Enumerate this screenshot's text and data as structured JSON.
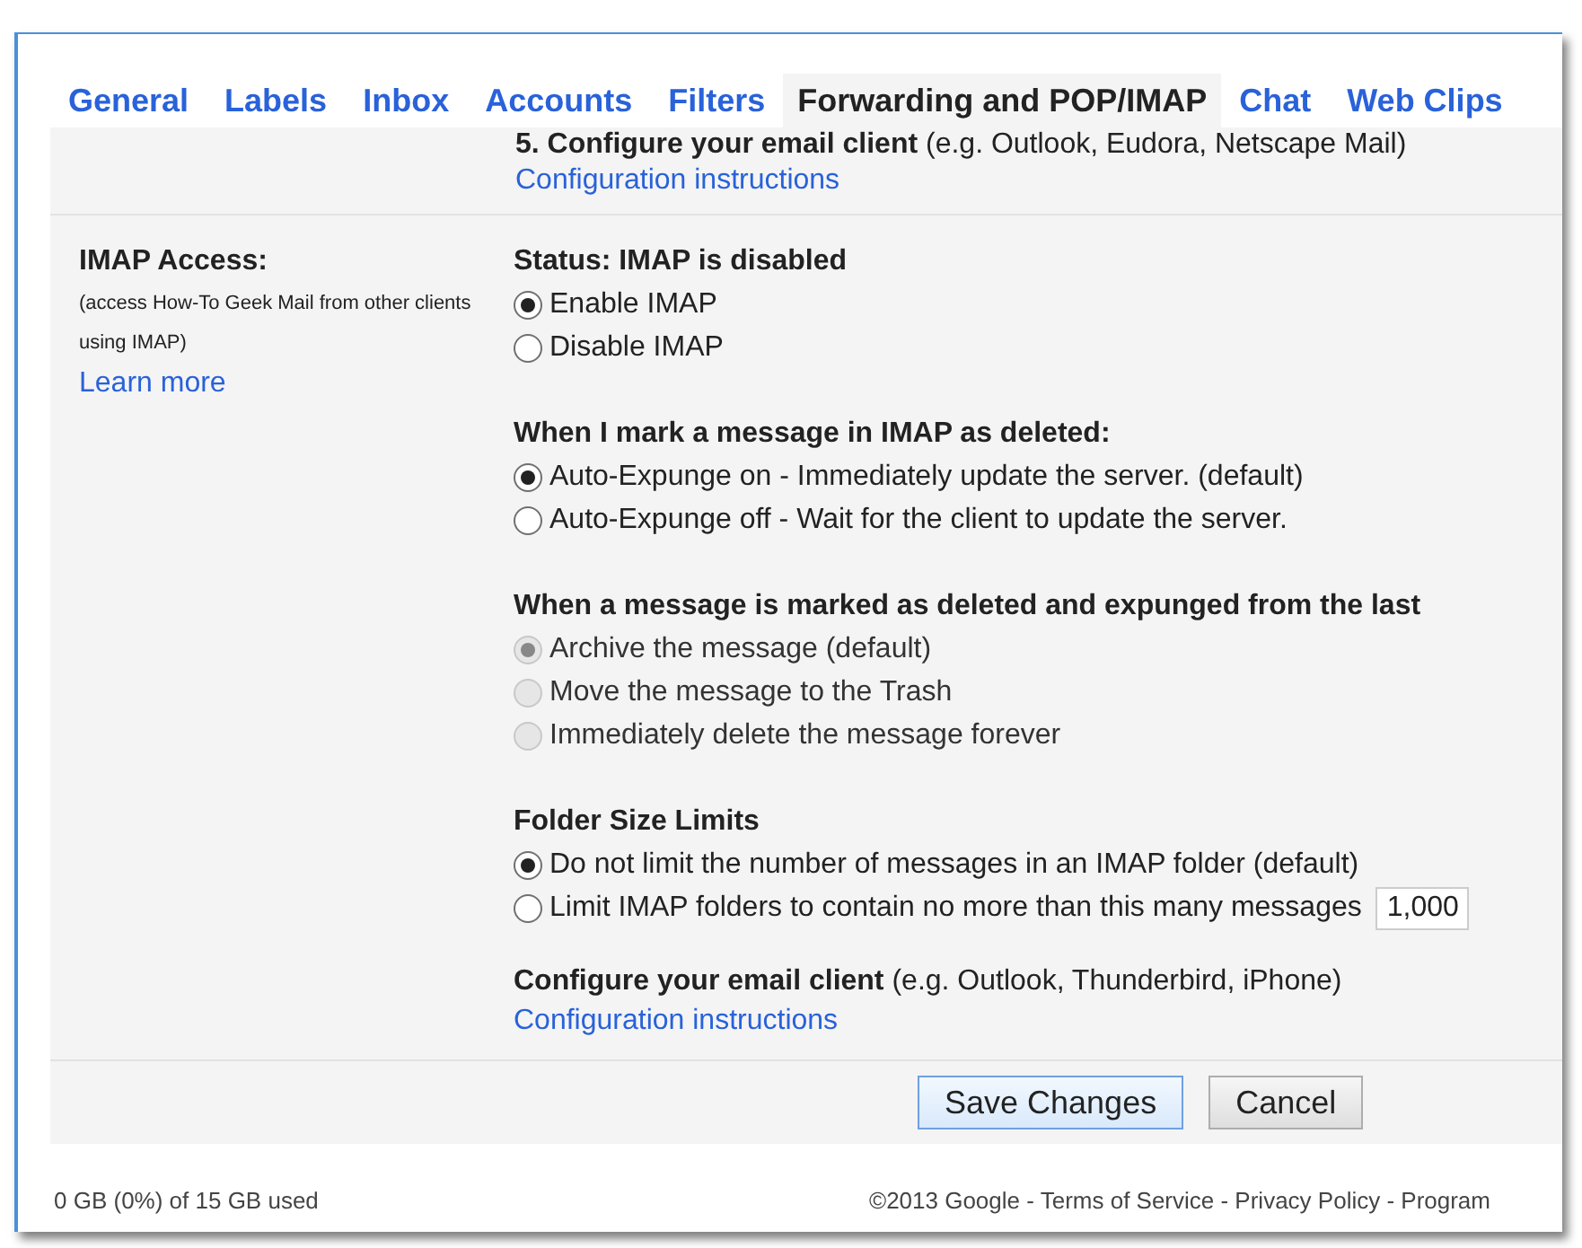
{
  "tabs": [
    {
      "label": "General",
      "selected": false
    },
    {
      "label": "Labels",
      "selected": false
    },
    {
      "label": "Inbox",
      "selected": false
    },
    {
      "label": "Accounts",
      "selected": false
    },
    {
      "label": "Filters",
      "selected": false
    },
    {
      "label": "Forwarding and POP/IMAP",
      "selected": true
    },
    {
      "label": "Chat",
      "selected": false
    },
    {
      "label": "Web Clips",
      "selected": false
    }
  ],
  "previous_row": {
    "heading": "5. Configure your email client",
    "note": "(e.g. Outlook, Eudora, Netscape Mail)",
    "link": "Configuration instructions"
  },
  "imap_access": {
    "label": "IMAP Access:",
    "description": "(access How-To Geek Mail from other clients using IMAP)",
    "link": "Learn more",
    "groups": [
      {
        "heading": "Status: IMAP is disabled",
        "options": [
          {
            "label": "Enable IMAP",
            "selected": true,
            "disabled": false
          },
          {
            "label": "Disable IMAP",
            "selected": false,
            "disabled": false
          }
        ]
      },
      {
        "heading": "When I mark a message in IMAP as deleted:",
        "options": [
          {
            "label": "Auto-Expunge on - Immediately update the server. (default)",
            "selected": true,
            "disabled": false
          },
          {
            "label": "Auto-Expunge off - Wait for the client to update the server.",
            "selected": false,
            "disabled": false
          }
        ]
      },
      {
        "heading": "When a message is marked as deleted and expunged from the last",
        "options": [
          {
            "label": "Archive the message (default)",
            "selected": true,
            "disabled": true
          },
          {
            "label": "Move the message to the Trash",
            "selected": false,
            "disabled": true
          },
          {
            "label": "Immediately delete the message forever",
            "selected": false,
            "disabled": true
          }
        ]
      },
      {
        "heading": "Folder Size Limits",
        "options": [
          {
            "label": "Do not limit the number of messages in an IMAP folder (default)",
            "selected": true,
            "disabled": false
          },
          {
            "label": "Limit IMAP folders to contain no more than this many messages",
            "selected": false,
            "disabled": false,
            "value": "1,000"
          }
        ]
      }
    ],
    "configure": {
      "heading": "Configure your email client",
      "note": "(e.g. Outlook, Thunderbird, iPhone)",
      "link": "Configuration instructions"
    }
  },
  "buttons": [
    {
      "label": "Save Changes",
      "kind": "primary"
    },
    {
      "label": "Cancel",
      "kind": "secondary"
    }
  ],
  "footer": {
    "usage": "0 GB (0%) of 15 GB used",
    "legal": "©2013 Google - Terms of Service - Privacy Policy - Program"
  }
}
